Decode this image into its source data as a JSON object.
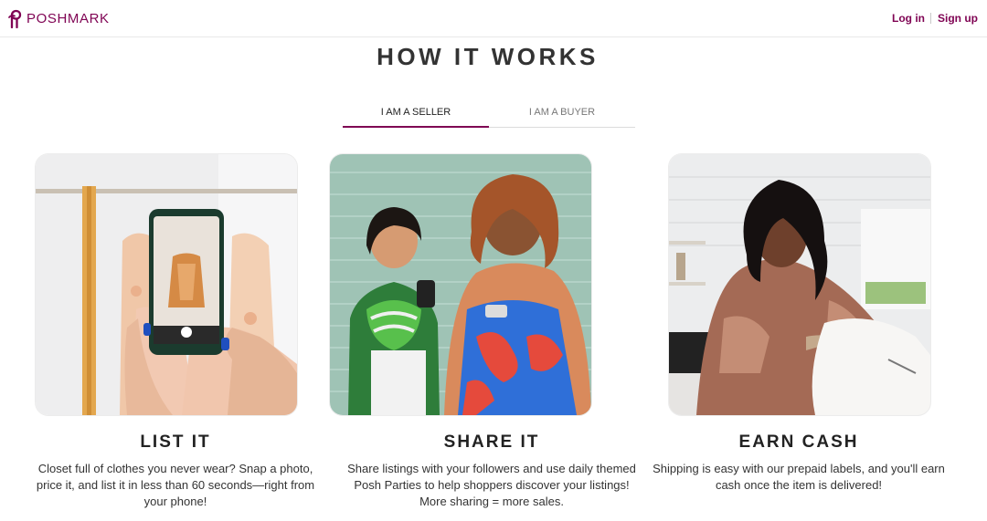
{
  "header": {
    "brand": "POSHMARK",
    "login_label": "Log in",
    "signup_label": "Sign up"
  },
  "page": {
    "title": "HOW IT WORKS"
  },
  "tabs": [
    {
      "label": "I AM A SELLER",
      "active": true
    },
    {
      "label": "I AM A BUYER",
      "active": false
    }
  ],
  "steps": [
    {
      "title": "LIST IT",
      "description": "Closet full of clothes you never wear? Snap a photo, price it, and list it in less than 60 seconds—right from your phone!",
      "image": "phone-photo-of-clothes"
    },
    {
      "title": "SHARE IT",
      "description": "Share listings with your followers and use daily themed Posh Parties to help shoppers discover your listings! More sharing = more sales.",
      "image": "two-women-with-phones"
    },
    {
      "title": "EARN CASH",
      "description": "Shipping is easy with our prepaid labels, and you'll earn cash once the item is delivered!",
      "image": "woman-packing-item"
    }
  ],
  "colors": {
    "brand": "#7f0353",
    "text": "#222222"
  }
}
